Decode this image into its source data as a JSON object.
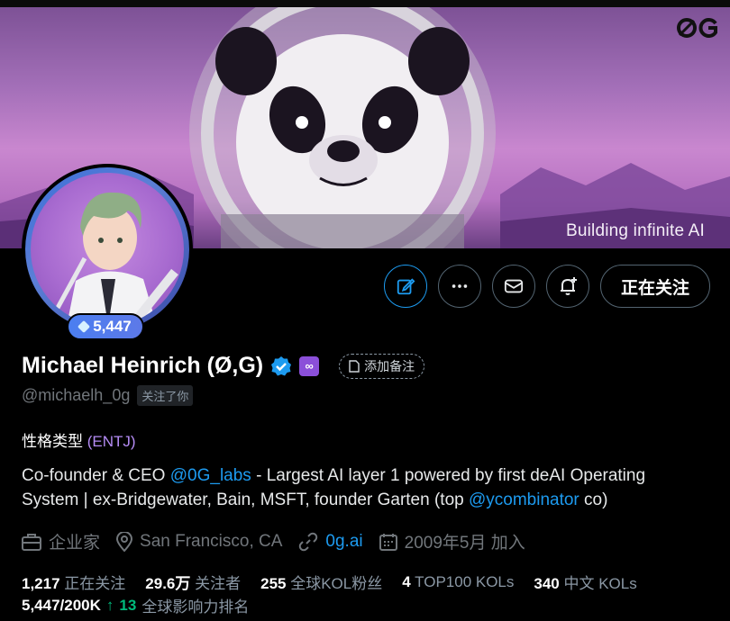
{
  "banner": {
    "caption": "Building infinite AI",
    "logo_text": "0G"
  },
  "avatar": {
    "badge_value": "5,447"
  },
  "actions": {
    "follow_label": "正在关注"
  },
  "profile": {
    "display_name": "Michael Heinrich (Ø,G)",
    "badge_text": "∞",
    "note_label": "添加备注",
    "handle": "@michaelh_0g",
    "follows_you": "关注了你",
    "mbti_label": "性格类型",
    "mbti_type": "(ENTJ)"
  },
  "bio": {
    "part1": "Co-founder & CEO ",
    "mention1": "@0G_labs",
    "part2": " - Largest AI layer 1 powered by first deAI Operating System | ex-Bridgewater, Bain, MSFT, founder Garten (top ",
    "mention2": "@ycombinator",
    "part3": " co)"
  },
  "meta": {
    "profession": "企业家",
    "location": "San Francisco, CA",
    "website": "0g.ai",
    "joined": "2009年5月 加入"
  },
  "stats": {
    "following_num": "1,217",
    "following_label": "正在关注",
    "followers_num": "29.6万",
    "followers_label": "关注者",
    "kol_num": "255",
    "kol_label": "全球KOL粉丝",
    "top100_num": "4",
    "top100_label": "TOP100 KOLs",
    "cn_kol_num": "340",
    "cn_kol_label": "中文 KOLs",
    "rank_value": "5,447/200K",
    "rank_change": "13",
    "rank_label": "全球影响力排名"
  },
  "colors": {
    "accent": "#1d9bf0",
    "mbti": "#b58cf5",
    "up": "#00ba7c",
    "banner_purple": "#c987cf"
  }
}
